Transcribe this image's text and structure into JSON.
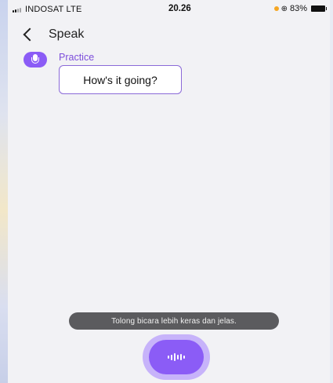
{
  "status_bar": {
    "carrier": "INDOSAT  LTE",
    "time": "20.26",
    "battery": "83%"
  },
  "header": {
    "title": "Speak"
  },
  "message": {
    "sender": "Practice",
    "text": "How's it going?"
  },
  "toast": {
    "text": "Tolong bicara lebih keras dan jelas."
  },
  "colors": {
    "accent": "#8b5cf6",
    "sender": "#7c4ddb",
    "toast_bg": "#5b5b5e"
  },
  "icons": {
    "back": "chevron-left-icon",
    "avatar": "microphone-icon",
    "mic_button": "sound-wave-icon"
  }
}
